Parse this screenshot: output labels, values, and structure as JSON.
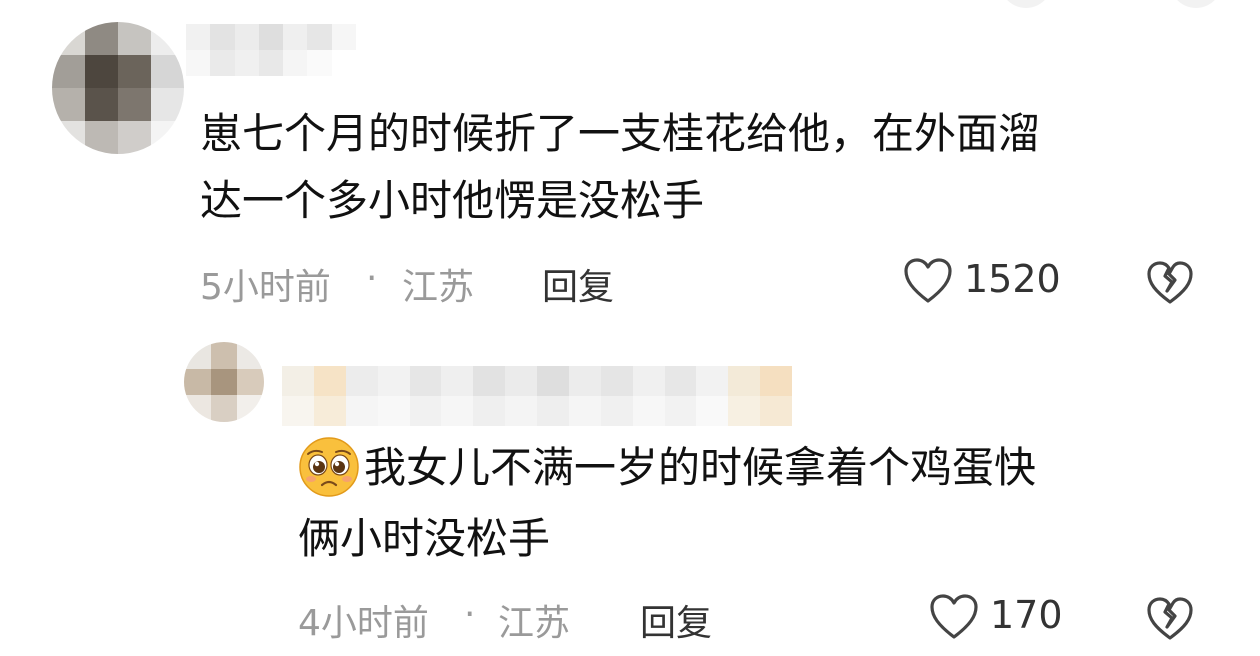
{
  "comments": [
    {
      "text_line1": "崽七个月的时候折了一支桂花给他，在外面溜",
      "text_line2": "达一个多小时他愣是没松手",
      "time": "5小时前",
      "location": "江苏",
      "separator": "·",
      "reply_label": "回复",
      "likes": "1520"
    },
    {
      "emoji": "pleading-face-emoji",
      "text_line1": "我女儿不满一岁的时候拿着个鸡蛋快",
      "text_line2": "俩小时没松手",
      "time": "4小时前",
      "location": "江苏",
      "separator": "·",
      "reply_label": "回复",
      "likes": "170"
    }
  ],
  "icons": {
    "like": "heart-outline-icon",
    "dislike": "broken-heart-icon"
  }
}
